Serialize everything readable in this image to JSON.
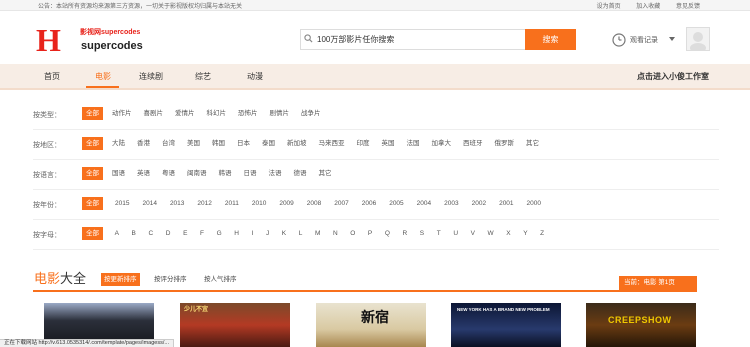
{
  "notice": {
    "text": "公告：本站所有资源均来源第三方资源，一切关于影视版权均归属与本站无关",
    "links": [
      "设为首页",
      "加入收藏",
      "意见反馈"
    ]
  },
  "header": {
    "logo_letter": "H",
    "brand_cn": "影视网supercodes",
    "brand_en": "supercodes",
    "search_value": "100万部影片任你搜索",
    "search_button": "搜索",
    "history_label": "观看记录"
  },
  "nav": {
    "items": [
      "首页",
      "电影",
      "连续剧",
      "综艺",
      "动漫"
    ],
    "active": "电影",
    "right": "点击进入小俊工作室"
  },
  "filters": {
    "type": {
      "label": "按类型：",
      "options": [
        "全部",
        "动作片",
        "喜剧片",
        "爱情片",
        "科幻片",
        "恐怖片",
        "剧情片",
        "战争片"
      ]
    },
    "region": {
      "label": "按地区：",
      "options": [
        "全部",
        "大陆",
        "香港",
        "台湾",
        "美国",
        "韩国",
        "日本",
        "泰国",
        "新加坡",
        "马来西亚",
        "印度",
        "英国",
        "法国",
        "加拿大",
        "西班牙",
        "俄罗斯",
        "其它"
      ]
    },
    "language": {
      "label": "按语言：",
      "options": [
        "全部",
        "国语",
        "英语",
        "粤语",
        "闽南语",
        "韩语",
        "日语",
        "法语",
        "德语",
        "其它"
      ]
    },
    "year": {
      "label": "按年份：",
      "options": [
        "全部",
        "2015",
        "2014",
        "2013",
        "2012",
        "2011",
        "2010",
        "2009",
        "2008",
        "2007",
        "2006",
        "2005",
        "2004",
        "2003",
        "2002",
        "2001",
        "2000"
      ]
    },
    "letter": {
      "label": "按字母：",
      "options": [
        "全部",
        "A",
        "B",
        "C",
        "D",
        "E",
        "F",
        "G",
        "H",
        "I",
        "J",
        "K",
        "L",
        "M",
        "N",
        "O",
        "P",
        "Q",
        "R",
        "S",
        "T",
        "U",
        "V",
        "W",
        "X",
        "Y",
        "Z"
      ]
    }
  },
  "section": {
    "title_accent": "电影",
    "title_rest": "大全",
    "sort_tabs": [
      "按更新排序",
      "按评分排序",
      "按人气排序"
    ],
    "current": "当前：电影  第1页"
  },
  "posters": [
    {
      "text": ""
    },
    {
      "text": "少儿不宜"
    },
    {
      "text": "新宿"
    },
    {
      "text": "NEW YORK HAS A BRAND NEW PROBLEM"
    },
    {
      "text": "CREEPSHOW"
    }
  ],
  "status_bar": "正在下载网站 http://v.613.0535314/.com/template/pages/imagess/..."
}
